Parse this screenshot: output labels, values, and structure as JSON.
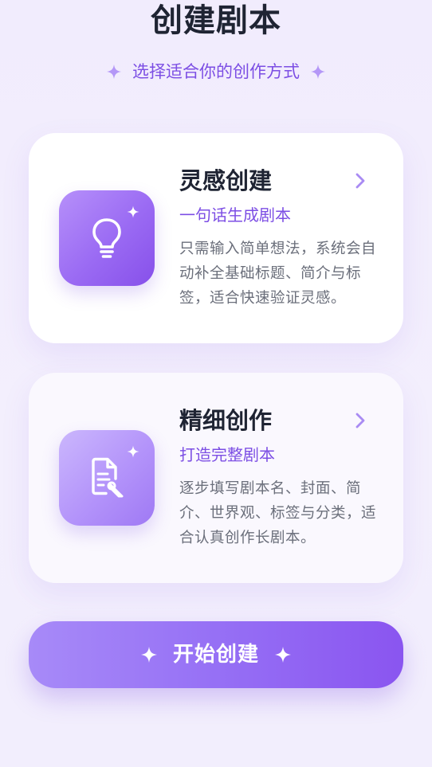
{
  "header": {
    "title": "创建剧本",
    "subtitle": "选择适合你的创作方式"
  },
  "cards": [
    {
      "title": "灵感创建",
      "tagline": "一句话生成剧本",
      "description": "只需输入简单想法，系统会自动补全基础标题、简介与标签，适合快速验证灵感。",
      "icon": "lightbulb-icon"
    },
    {
      "title": "精细创作",
      "tagline": "打造完整剧本",
      "description": "逐步填写剧本名、封面、简介、世界观、标签与分类，适合认真创作长剧本。",
      "icon": "document-edit-icon"
    }
  ],
  "start_button": {
    "label": "开始创建"
  },
  "colors": {
    "accent": "#7c4ee4",
    "title": "#1f2433",
    "body_text": "#6b6f7b",
    "background": "#f2eefd"
  }
}
